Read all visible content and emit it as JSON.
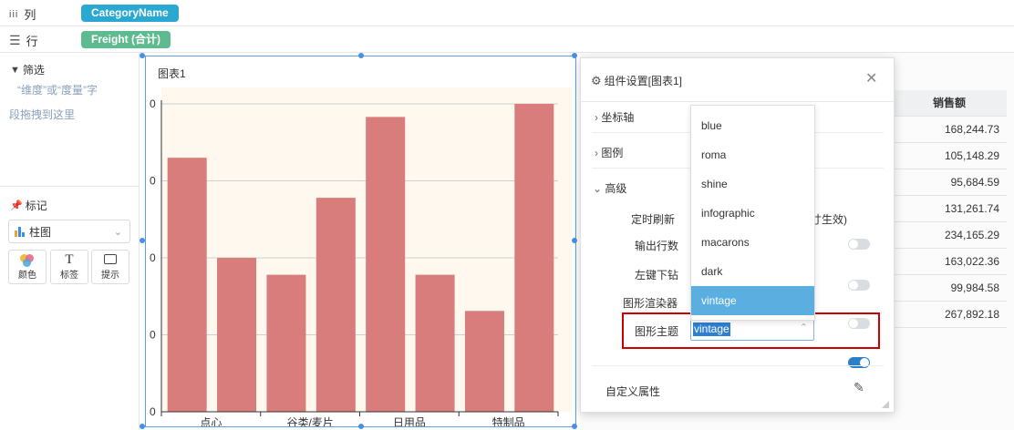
{
  "shelf": {
    "columns_label": "列",
    "columns_pill": "CategoryName",
    "rows_label": "行",
    "rows_pill": "Freight (合计)",
    "columns_color": "#2ba8d2",
    "rows_color": "#5dbb8f"
  },
  "filter": {
    "title": "筛选",
    "hint_line1": "“维度”或“度量”字",
    "hint_line2": "段拖拽到这里"
  },
  "marks": {
    "title": "标记",
    "chart_type": "柱图",
    "buttons": [
      "颜色",
      "标签",
      "提示"
    ]
  },
  "chart": {
    "title": "图表1",
    "bar_color": "#d87c7c",
    "bg_color": "#fef8ef",
    "y_tick_labels": [
      "0",
      "0",
      "0",
      "0",
      "0"
    ]
  },
  "chart_data": {
    "type": "bar",
    "categories": [
      "点心",
      "",
      "谷类/麦片",
      "",
      "日用品",
      "",
      "特制品",
      ""
    ],
    "values": [
      33,
      20,
      17.8,
      27.8,
      38.3,
      17.8,
      13.1,
      40
    ],
    "title": "图表1",
    "xlabel": "",
    "ylabel": "",
    "ylim": [
      0,
      40
    ],
    "grid": true
  },
  "table": {
    "header": "销售额",
    "values": [
      "168,244.73",
      "105,148.29",
      "95,684.59",
      "131,261.74",
      "234,165.29",
      "163,022.36",
      "99,984.58",
      "267,892.18"
    ]
  },
  "dialog": {
    "title": "组件设置[图表1]",
    "sections": [
      "坐标轴",
      "图例",
      "高级"
    ],
    "rows": [
      {
        "label": "定时刷新",
        "suffix": "寸生效)"
      },
      {
        "label": "输出行数",
        "toggle": false
      },
      {
        "label": "左键下钻",
        "toggle": false
      },
      {
        "label": "图形渲染器",
        "toggle": false
      },
      {
        "label": "图形主题",
        "toggle": true
      }
    ],
    "theme_value": "vintage",
    "theme_options": [
      "blue",
      "roma",
      "shine",
      "infographic",
      "macarons",
      "dark",
      "vintage"
    ],
    "selected_option": "vintage",
    "custom_props": "自定义属性",
    "highlight_color": "#cc0000"
  }
}
